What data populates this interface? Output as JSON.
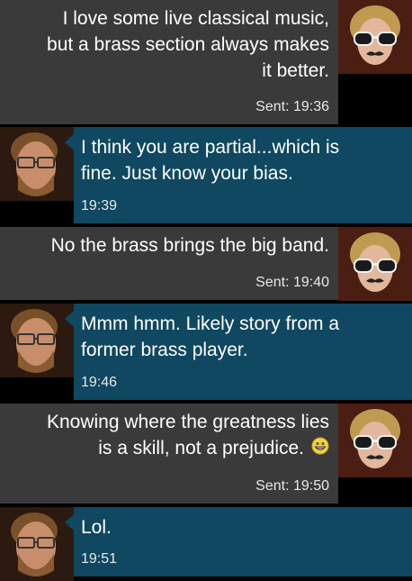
{
  "messages": [
    {
      "dir": "sent",
      "text": [
        "I love some live classical music,",
        "but a brass section always makes",
        "it better."
      ],
      "time": "Sent: 19:36",
      "avatar": "woman-sunglasses-avatar"
    },
    {
      "dir": "recv",
      "text": [
        "I think you are partial...which is",
        "fine.  Just know your bias."
      ],
      "time": "19:39",
      "avatar": "man-glasses-avatar"
    },
    {
      "dir": "sent",
      "text": [
        "No the brass brings the big band."
      ],
      "time": "Sent: 19:40",
      "avatar": "woman-sunglasses-avatar"
    },
    {
      "dir": "recv",
      "text": [
        "Mmm hmm. Likely story from a",
        "former brass player."
      ],
      "time": "19:46",
      "avatar": "man-glasses-avatar"
    },
    {
      "dir": "sent",
      "text": [
        "Knowing where the greatness lies",
        "is a skill, not a prejudice."
      ],
      "time": "Sent: 19:50",
      "avatar": "woman-sunglasses-avatar",
      "emoji": "grinning-emoji-icon"
    },
    {
      "dir": "recv",
      "text": [
        "Lol."
      ],
      "time": "19:51",
      "avatar": "man-glasses-avatar"
    }
  ],
  "colors": {
    "sent_bubble": "#3a3a3a",
    "recv_bubble": "#0f4860",
    "background": "#000000"
  }
}
